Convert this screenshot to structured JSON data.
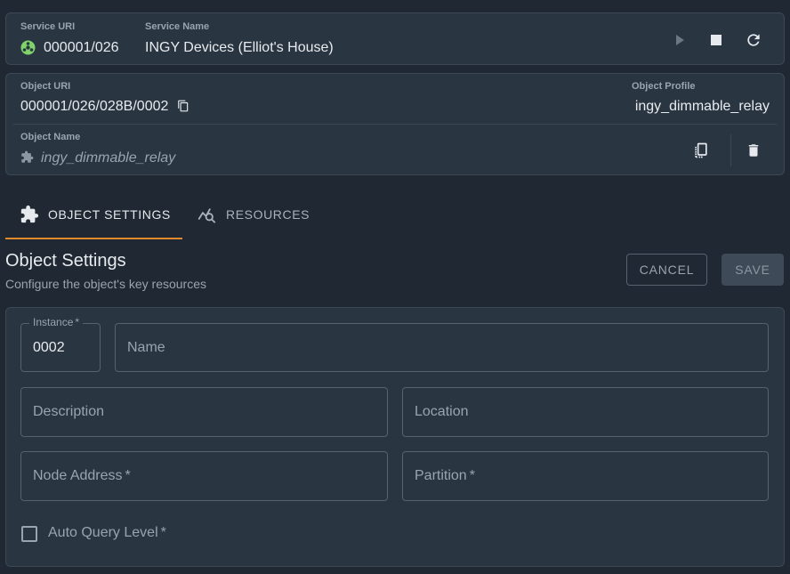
{
  "service": {
    "uri_label": "Service URI",
    "uri_value": "000001/026",
    "name_label": "Service Name",
    "name_value": "INGY Devices (Elliot's House)",
    "status_color": "#7fd36a"
  },
  "object": {
    "uri_label": "Object URI",
    "uri_value": "000001/026/028B/0002",
    "profile_label": "Object Profile",
    "profile_value": "ingy_dimmable_relay",
    "name_label": "Object Name",
    "name_value": "ingy_dimmable_relay"
  },
  "tabs": [
    {
      "label": "OBJECT SETTINGS",
      "active": true
    },
    {
      "label": "RESOURCES",
      "active": false
    }
  ],
  "settings": {
    "title": "Object Settings",
    "subtitle": "Configure the object's key resources",
    "cancel_label": "CANCEL",
    "save_label": "SAVE"
  },
  "form": {
    "instance_label": "Instance",
    "instance_value": "0002",
    "name_placeholder": "Name",
    "description_placeholder": "Description",
    "location_placeholder": "Location",
    "node_address_placeholder": "Node Address",
    "partition_placeholder": "Partition",
    "auto_query_label": "Auto Query Level",
    "required_marker": "*"
  },
  "colors": {
    "accent": "#e08a2c",
    "background": "#1f2833",
    "card": "#2a3542"
  }
}
